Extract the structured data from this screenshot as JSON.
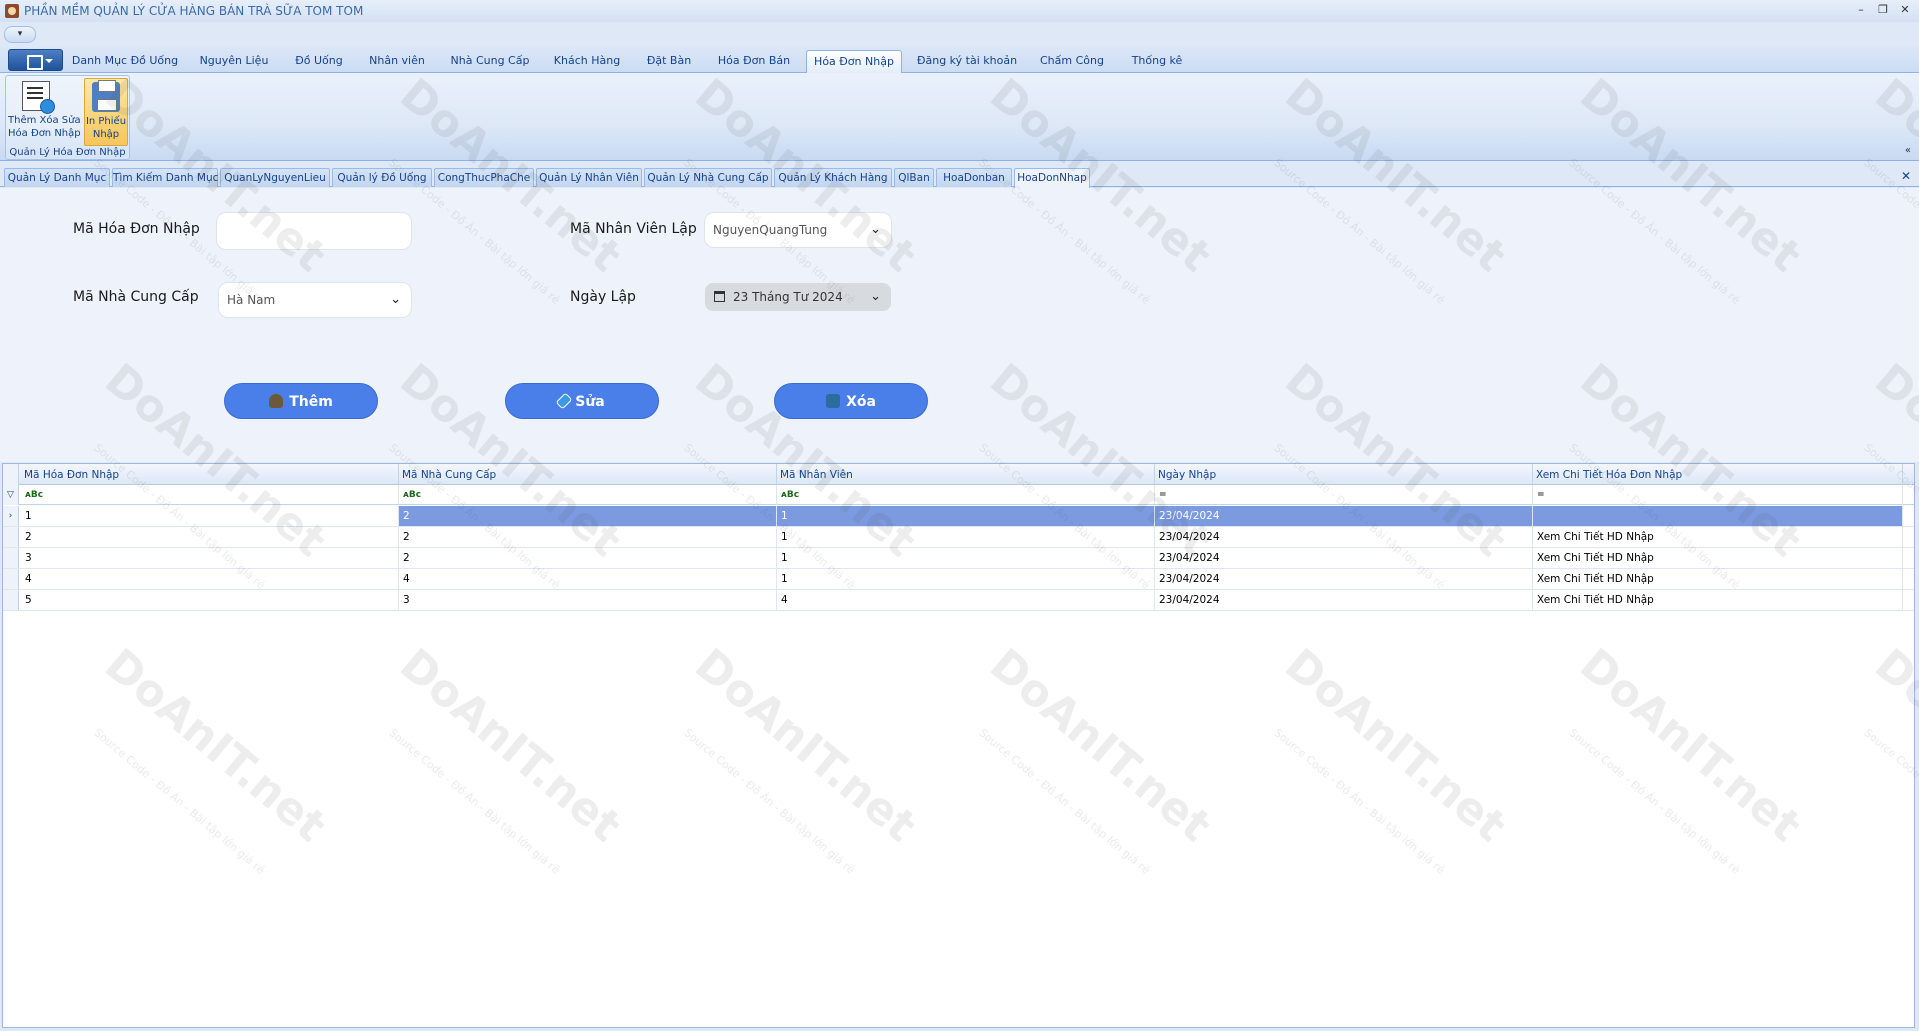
{
  "window": {
    "title": "PHẦN MỀM QUẢN LÝ CỬA HÀNG BÁN TRÀ SỮA TOM TOM",
    "controls": [
      "–",
      "❐",
      "✕"
    ]
  },
  "qat": {
    "label": "▾"
  },
  "ribbon": {
    "tabs": [
      "Danh Mục Đồ Uống",
      "Nguyên Liệu",
      "Đồ Uống",
      "Nhân viên",
      "Nhà Cung Cấp",
      "Khách Hàng",
      "Đặt Bàn",
      "Hóa Đơn Bán",
      "Hóa Đơn Nhập",
      "Đăng ký tài khoản",
      "Chấm Công",
      "Thống kê"
    ],
    "active_tab": "Hóa Đơn Nhập",
    "group": {
      "label": "Quản Lý Hóa Đơn Nhập",
      "btn1_line1": "Thêm Xóa Sửa",
      "btn1_line2": "Hóa Đơn Nhập",
      "btn2_line1": "In Phiếu",
      "btn2_line2": "Nhập"
    },
    "collapse_icon": "«"
  },
  "doc_tabs": [
    "Quản Lý Danh Mục",
    "Tìm Kiếm Danh Mục",
    "QuanLyNguyenLieu",
    "Quản lý Đồ Uống",
    "CongThucPhaChe",
    "Quản Lý Nhân Viên",
    "Quản Lý Nhà Cung Cấp",
    "Quản Lý Khách Hàng",
    "QlBan",
    "HoaDonban",
    "HoaDonNhap"
  ],
  "doc_close": "✕",
  "form": {
    "ma_hdn_label": "Mã Hóa Đơn Nhập",
    "ma_hdn_value": "",
    "ma_ncc_label": "Mã Nhà Cung Cấp",
    "ma_ncc_value": "Hà Nam",
    "ma_nv_label": "Mã Nhân Viên Lập",
    "ma_nv_value": "NguyenQuangTung",
    "ngay_lap_label": "Ngày Lập",
    "ngay_lap_value": "23 Tháng Tư 2024",
    "btn_them": "Thêm",
    "btn_sua": "Sửa",
    "btn_xoa": "Xóa"
  },
  "grid": {
    "headers": [
      "Mã Hóa Đơn Nhập",
      "Mã Nhà Cung Cấp",
      "Mã Nhân Viên",
      "Ngày Nhập",
      "Xem Chi Tiết Hóa Đơn Nhập"
    ],
    "filters": [
      "ᴀBc",
      "ᴀBc",
      "ᴀBc",
      "=",
      "="
    ],
    "rows": [
      [
        "1",
        "2",
        "1",
        "23/04/2024",
        ""
      ],
      [
        "2",
        "2",
        "1",
        "23/04/2024",
        "Xem Chi Tiết HD Nhập"
      ],
      [
        "3",
        "2",
        "1",
        "23/04/2024",
        "Xem Chi Tiết HD Nhập"
      ],
      [
        "4",
        "4",
        "1",
        "23/04/2024",
        "Xem Chi Tiết HD Nhập"
      ],
      [
        "5",
        "3",
        "4",
        "23/04/2024",
        "Xem Chi Tiết HD Nhập"
      ]
    ],
    "selected_row": 0,
    "filter_indicator": "▽",
    "row_indicator": "›"
  },
  "watermark": {
    "text": "DoAnIT.net",
    "sub": "Source Code - Đồ Án - Bài tập lớn giá rẻ"
  }
}
